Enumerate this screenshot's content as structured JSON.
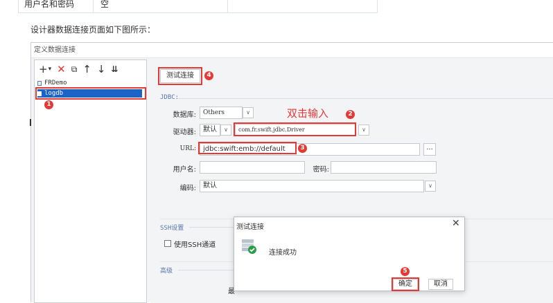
{
  "top_table": {
    "col1": "用户名和密码",
    "col2": "空"
  },
  "intro_text": "设计器数据连接页面如下图所示：",
  "window": {
    "title": "定义数据连接",
    "toolbar": [
      {
        "icon": "add-icon",
        "glyph": "+"
      },
      {
        "icon": "dropdown-arrow-icon",
        "glyph": "▾"
      },
      {
        "icon": "delete-icon",
        "glyph": "✕"
      },
      {
        "icon": "copy-icon",
        "glyph": "⧉"
      },
      {
        "icon": "move-up-icon",
        "glyph": "↑"
      },
      {
        "icon": "move-down-icon",
        "glyph": "↓"
      },
      {
        "icon": "sort-icon",
        "glyph": "⇊"
      }
    ],
    "connections": [
      "FRDemo",
      "logdb"
    ],
    "selected_connection": "logdb",
    "test_button": "测试连接",
    "jdbc_section": "JDBC:",
    "database_label": "数据库:",
    "database_value": "Others",
    "driver_label": "驱动器:",
    "driver_mode": "默认",
    "driver_value": "com.fr.swift.jdbc.Driver",
    "url_label": "URL:",
    "url_value": "jdbc:swift:emb://default",
    "url_more": "...",
    "username_label": "用户名:",
    "username_value": "",
    "password_label": "密码:",
    "password_value": "",
    "encoding_label": "编码:",
    "encoding_value": "默认",
    "ssh_section": "SSH设置",
    "ssh_checkbox": "使用SSH通道",
    "advanced_section": "高级",
    "advanced_partial_label": "最"
  },
  "annotations": {
    "double_click_note": "双击输入",
    "markers": [
      "1",
      "2",
      "3",
      "4",
      "5"
    ]
  },
  "dialog": {
    "title": "测试连接",
    "close": "✕",
    "message": "连接成功",
    "ok_button": "确定",
    "cancel_button": "取消"
  },
  "colors": {
    "annotation_red": "#e53935",
    "selection_blue": "#1a63c9",
    "success_green": "#2e9d4a"
  }
}
